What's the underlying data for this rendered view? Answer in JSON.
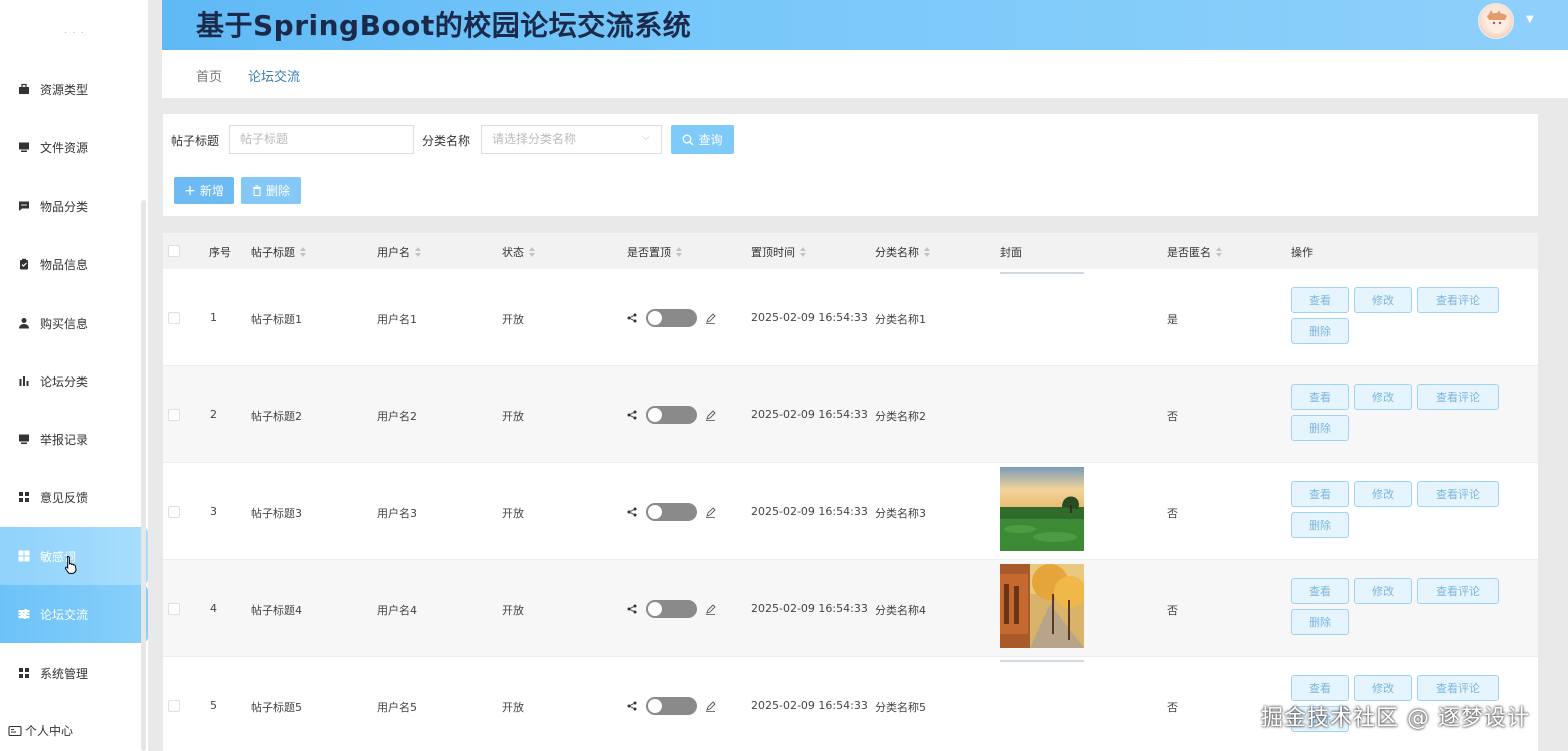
{
  "header": {
    "title": "基于SpringBoot的校园论坛交流系统"
  },
  "breadcrumb": {
    "home": "首页",
    "current": "论坛交流"
  },
  "sidebar": {
    "items": [
      {
        "label": "资源类型",
        "icon": "briefcase-icon"
      },
      {
        "label": "文件资源",
        "icon": "monitor-icon"
      },
      {
        "label": "物品分类",
        "icon": "message-icon"
      },
      {
        "label": "物品信息",
        "icon": "clipboard-icon"
      },
      {
        "label": "购买信息",
        "icon": "user-icon"
      },
      {
        "label": "论坛分类",
        "icon": "bar-chart-icon"
      },
      {
        "label": "举报记录",
        "icon": "monitor-icon"
      },
      {
        "label": "意见反馈",
        "icon": "grid-icon"
      },
      {
        "label": "敏感词",
        "icon": "grid-icon"
      },
      {
        "label": "论坛交流",
        "icon": "sliders-icon"
      },
      {
        "label": "系统管理",
        "icon": "grid-icon"
      }
    ],
    "personal": "个人中心"
  },
  "search": {
    "title_label": "帖子标题",
    "title_placeholder": "帖子标题",
    "category_label": "分类名称",
    "category_placeholder": "请选择分类名称",
    "query_button": "查询",
    "add_button": "新增",
    "delete_button": "删除"
  },
  "table": {
    "headers": {
      "index": "序号",
      "title": "帖子标题",
      "username": "用户名",
      "status": "状态",
      "pinned": "是否置顶",
      "pin_time": "置顶时间",
      "category": "分类名称",
      "cover": "封面",
      "anonymous": "是否匿名",
      "actions": "操作"
    },
    "rows": [
      {
        "index": "1",
        "title": "帖子标题1",
        "username": "用户名1",
        "status": "开放",
        "pin_time": "2025-02-09 16:54:33",
        "category": "分类名称1",
        "anonymous": "是",
        "pinned": false
      },
      {
        "index": "2",
        "title": "帖子标题2",
        "username": "用户名2",
        "status": "开放",
        "pin_time": "2025-02-09 16:54:33",
        "category": "分类名称2",
        "anonymous": "否",
        "pinned": false
      },
      {
        "index": "3",
        "title": "帖子标题3",
        "username": "用户名3",
        "status": "开放",
        "pin_time": "2025-02-09 16:54:33",
        "category": "分类名称3",
        "anonymous": "否",
        "pinned": false
      },
      {
        "index": "4",
        "title": "帖子标题4",
        "username": "用户名4",
        "status": "开放",
        "pin_time": "2025-02-09 16:54:33",
        "category": "分类名称4",
        "anonymous": "否",
        "pinned": false
      },
      {
        "index": "5",
        "title": "帖子标题5",
        "username": "用户名5",
        "status": "开放",
        "pin_time": "2025-02-09 16:54:33",
        "category": "分类名称5",
        "anonymous": "否",
        "pinned": false
      }
    ],
    "actions": {
      "view": "查看",
      "edit": "修改",
      "view_comments": "查看评论",
      "delete": "删除"
    }
  },
  "watermark": "掘金技术社区 @ 逐梦设计",
  "colors": {
    "accent": "#6cc2f8",
    "header_text": "#1b2a4a",
    "action_border": "#9ed3f4"
  }
}
